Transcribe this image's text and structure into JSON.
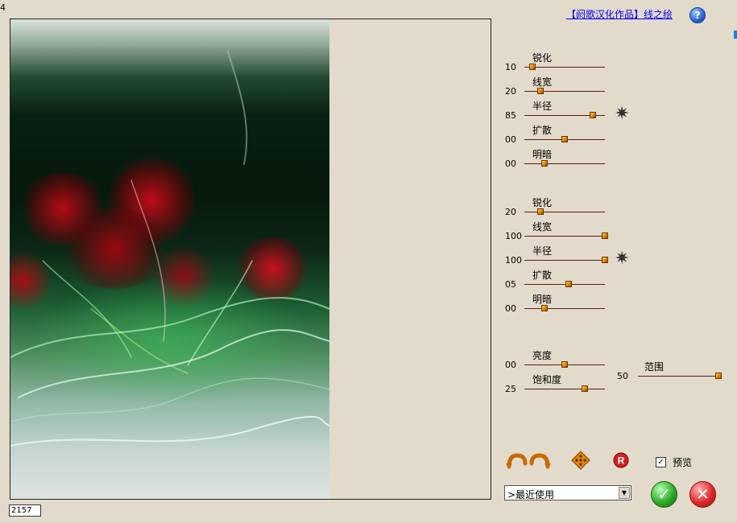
{
  "header": {
    "title": "【阏歌汉化作品】线之绘",
    "help_icon": "?"
  },
  "status": {
    "coords_value": "2157"
  },
  "markers": {
    "left": "4"
  },
  "group1": {
    "sliders": [
      {
        "label": "锐化",
        "value": "10",
        "level": 0.1
      },
      {
        "label": "线宽",
        "value": "20",
        "level": 0.2
      },
      {
        "label": "半径",
        "value": "85",
        "level": 0.85
      },
      {
        "label": "扩散",
        "value": "00",
        "level": 0.5
      },
      {
        "label": "明暗",
        "value": "00",
        "level": 0.25
      }
    ]
  },
  "group2": {
    "sliders": [
      {
        "label": "锐化",
        "value": "20",
        "level": 0.2
      },
      {
        "label": "线宽",
        "value": "100",
        "level": 1.0
      },
      {
        "label": "半径",
        "value": "100",
        "level": 1.0
      },
      {
        "label": "扩散",
        "value": "05",
        "level": 0.55
      },
      {
        "label": "明暗",
        "value": "00",
        "level": 0.25
      }
    ]
  },
  "group3": {
    "brightness": {
      "label": "亮度",
      "value": "00",
      "level": 0.5
    },
    "saturation": {
      "label": "饱和度",
      "value": "25",
      "level": 0.75
    },
    "range": {
      "label": "范围",
      "value": "50",
      "level": 1.0
    }
  },
  "toolbar": {
    "preview_label": "预览",
    "preview_checked": "✓"
  },
  "recent": {
    "selected": ">最近使用"
  },
  "colors": {
    "accent": "#e48800",
    "link": "#0000ee"
  }
}
